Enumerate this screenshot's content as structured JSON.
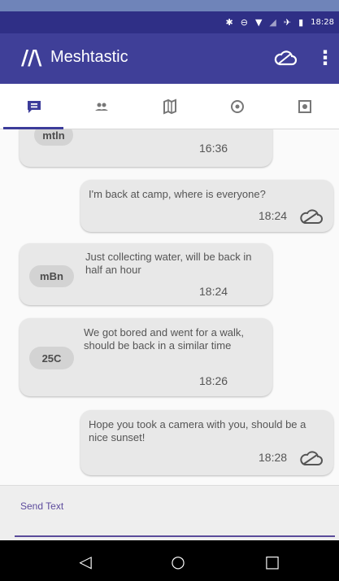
{
  "status_bar": {
    "icons": [
      "bluetooth-icon",
      "do-not-disturb-icon",
      "wifi-icon",
      "signal-icon",
      "airplane-icon",
      "battery-icon"
    ],
    "time": "18:28"
  },
  "app_bar": {
    "logo_text": "//\\",
    "title": "Meshtastic",
    "actions": [
      "cloud-icon",
      "more-vert-icon"
    ]
  },
  "tabs": [
    {
      "name": "messages",
      "icon": "chat-icon",
      "active": true
    },
    {
      "name": "nodes",
      "icon": "people-icon",
      "active": false
    },
    {
      "name": "map",
      "icon": "map-icon",
      "active": false
    },
    {
      "name": "channel",
      "icon": "radio-icon",
      "active": false
    },
    {
      "name": "settings",
      "icon": "settings-icon",
      "active": false
    }
  ],
  "messages": [
    {
      "sender": "mtln",
      "text": "",
      "time": "16:36",
      "outgoing": false
    },
    {
      "sender": "",
      "text": "I'm back at camp, where is everyone?",
      "time": "18:24",
      "outgoing": true
    },
    {
      "sender": "mBn",
      "text": "Just collecting water, will be back in half an hour",
      "time": "18:24",
      "outgoing": false
    },
    {
      "sender": "25C",
      "text": "We got bored and went for a walk, should be back in a similar time",
      "time": "18:26",
      "outgoing": false
    },
    {
      "sender": "",
      "text": "Hope you took a camera with you, should be a nice sunset!",
      "time": "18:28",
      "outgoing": true
    }
  ],
  "composer": {
    "placeholder": "Send Text"
  },
  "nav": {
    "back_icon": "back-icon",
    "home_icon": "home-icon",
    "recents_icon": "recents-icon"
  },
  "colors": {
    "primary": "#3f3f98",
    "status_bar": "#2f2f86",
    "accent": "#5a4b9a"
  }
}
